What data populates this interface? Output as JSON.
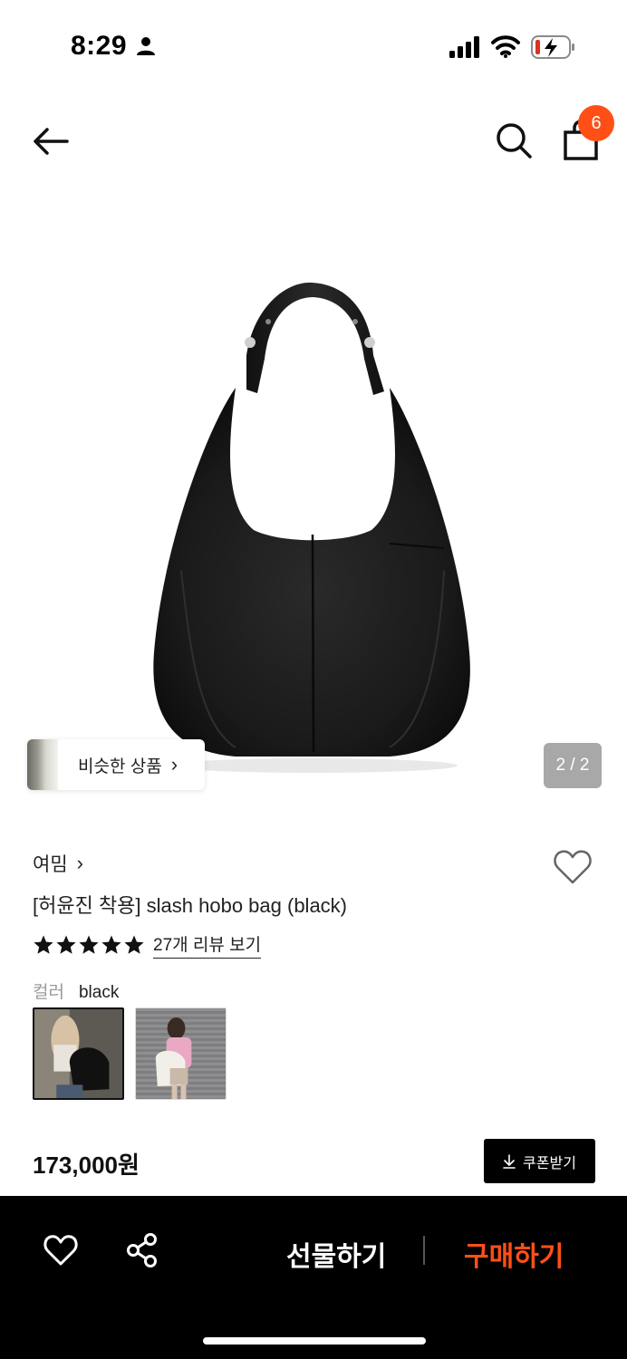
{
  "status_bar": {
    "time": "8:29"
  },
  "nav": {
    "cart_count": "6"
  },
  "gallery": {
    "similar_label": "비슷한 상품",
    "similar_chevron": "›",
    "page_indicator": "2 / 2"
  },
  "product": {
    "brand": "여밈",
    "brand_chevron": "›",
    "title": "[허윤진 착용] slash hobo bag (black)",
    "rating_stars": 5,
    "review_link": "27개 리뷰 보기",
    "color_label": "컬러",
    "color_value": "black",
    "price": "173,000원",
    "coupon_label": "쿠폰받기"
  },
  "bottom_bar": {
    "gift_label": "선물하기",
    "buy_label": "구매하기"
  },
  "colors": {
    "accent": "#ff4f17",
    "bar_bg": "#000000",
    "indicator_bg": "#a8a8a8"
  },
  "icons": [
    "person-icon",
    "signal-icon",
    "wifi-icon",
    "battery-icon",
    "back-arrow-icon",
    "search-icon",
    "shopping-bag-icon",
    "heart-icon",
    "star-icon",
    "download-icon",
    "share-icon"
  ]
}
